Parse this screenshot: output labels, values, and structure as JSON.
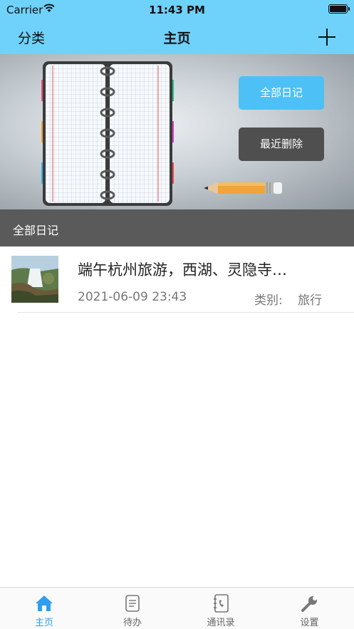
{
  "status_bar": {
    "carrier": "Carrier",
    "time": "11:43 PM"
  },
  "nav": {
    "left_label": "分类",
    "title": "主页",
    "add_icon": "plus-icon"
  },
  "banner": {
    "all_diaries_button": "全部日记",
    "recently_deleted_button": "最近删除"
  },
  "section": {
    "title": "全部日记"
  },
  "entries": [
    {
      "title": "端午杭州旅游，西湖、灵隐寺…",
      "date": "2021-06-09 23:43",
      "category_label": "类别:",
      "category": "旅行"
    }
  ],
  "tabs": [
    {
      "label": "主页",
      "icon": "home-icon",
      "active": true
    },
    {
      "label": "待办",
      "icon": "todo-icon",
      "active": false
    },
    {
      "label": "通讯录",
      "icon": "contacts-icon",
      "active": false
    },
    {
      "label": "设置",
      "icon": "wrench-icon",
      "active": false
    }
  ],
  "colors": {
    "nav_bg": "#6fd2fb",
    "accent": "#4dc1f6",
    "tab_active": "#2f9ef0",
    "section_bg": "#5a5a5a"
  }
}
